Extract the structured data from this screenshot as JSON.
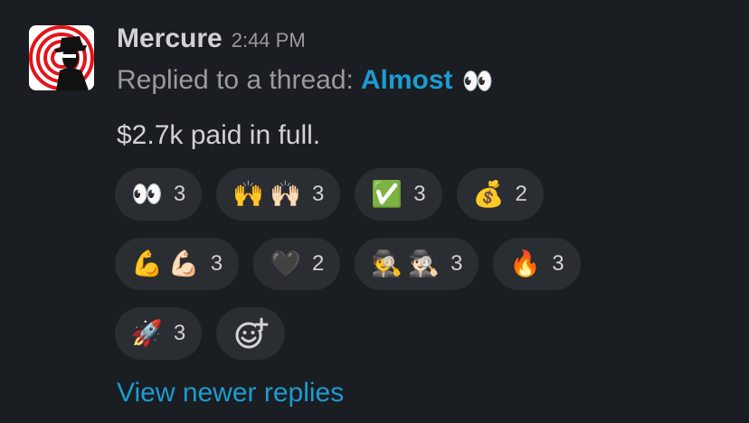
{
  "message": {
    "sender": "Mercure",
    "timestamp": "2:44 PM",
    "context_prefix": "Replied to a thread:",
    "thread_link": "Almost",
    "thread_emoji": "👀",
    "body": "$2.7k paid in full."
  },
  "reactions": {
    "row1": [
      {
        "emoji": "👀",
        "count": "3",
        "icon": "eyes-emoji"
      },
      {
        "emoji": "🙌🙌🏻",
        "count": "3",
        "icon": "raised-hands-emoji"
      },
      {
        "emoji": "✅",
        "count": "3",
        "icon": "white-check-mark-emoji"
      },
      {
        "emoji": "💰",
        "count": "2",
        "icon": "money-bag-emoji"
      }
    ],
    "row2": [
      {
        "emoji": "💪💪🏻",
        "count": "3",
        "icon": "flexed-biceps-emoji"
      },
      {
        "emoji": "🖤",
        "count": "2",
        "icon": "black-heart-emoji"
      },
      {
        "emoji": "🕵️🕵🏻",
        "count": "3",
        "icon": "detective-emoji"
      },
      {
        "emoji": "🔥",
        "count": "3",
        "icon": "fire-emoji"
      }
    ],
    "row3": [
      {
        "emoji": "🚀",
        "count": "3",
        "icon": "rocket-emoji"
      }
    ],
    "add_reaction_icon": "add-reaction-icon"
  },
  "view_newer_replies": "View newer replies",
  "colors": {
    "background": "#1a1d21",
    "link": "#1d9bd1",
    "pill": "#2a2d31",
    "muted": "#9a9b9d"
  }
}
